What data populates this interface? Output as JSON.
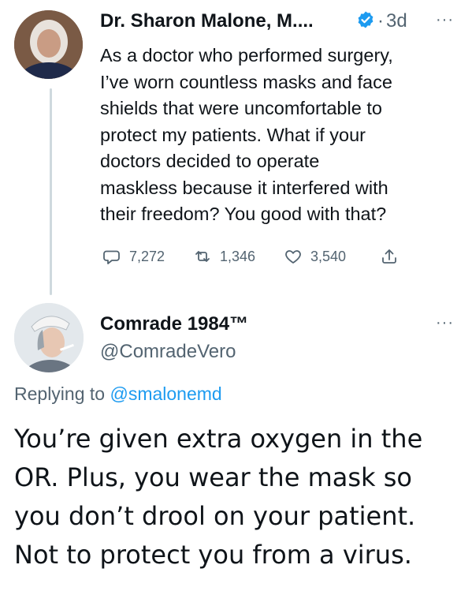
{
  "tweet": {
    "author_name": "Dr. Sharon Malone, M....",
    "time_sep": "·",
    "time": "3d",
    "more": "···",
    "lines": [
      "As a doctor who performed surgery,",
      "I’ve worn countless masks and face",
      "shields that were uncomfortable to",
      "protect my patients.  What if your",
      "doctors decided to operate",
      "maskless because it interfered with",
      "their freedom?  You good with that?"
    ],
    "replies": "7,272",
    "retweets": "1,346",
    "likes": "3,540"
  },
  "reply": {
    "author_name": "Comrade 1984™",
    "handle": "@ComradeVero",
    "more": "···",
    "replying_prefix": "Replying to",
    "replying_handle": "@smalonemd",
    "lines": [
      "You’re given extra oxygen in the",
      "OR. Plus, you wear the mask so",
      "you don’t drool on your patient.",
      "Not to protect you from a virus."
    ]
  },
  "colors": {
    "text": "#0f1419",
    "secondary": "#536471",
    "accent": "#1d9bf0",
    "thread_line": "#cfd9de"
  }
}
